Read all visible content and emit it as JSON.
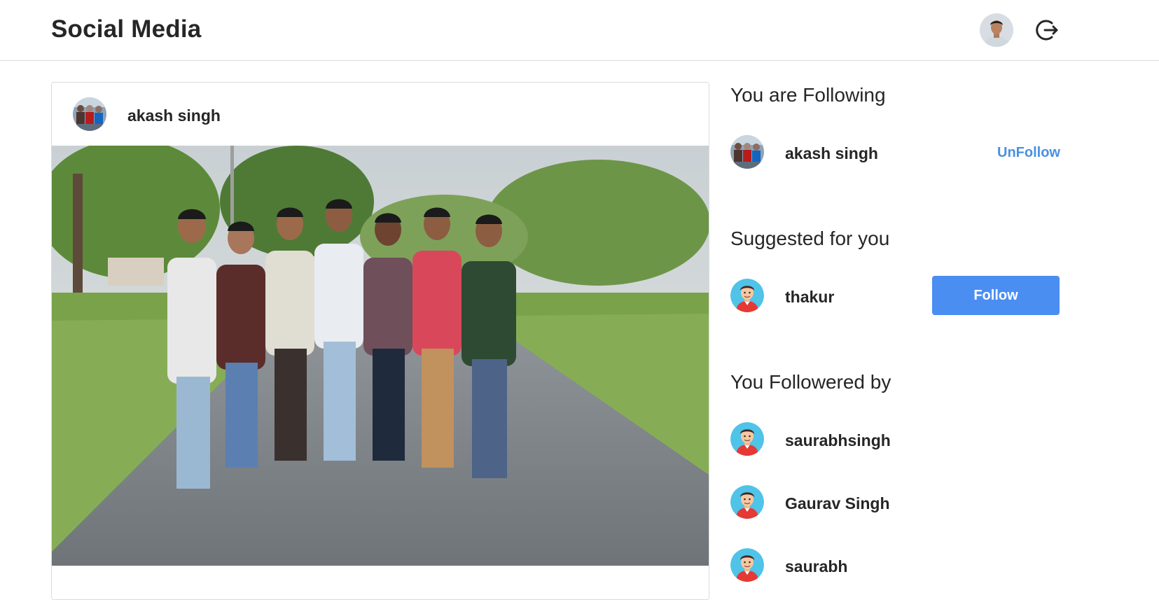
{
  "header": {
    "brand": "Social Media"
  },
  "post": {
    "username": "akash singh"
  },
  "following": {
    "title": "You are Following",
    "users": [
      {
        "name": "akash singh",
        "action": "UnFollow"
      }
    ]
  },
  "suggested": {
    "title": "Suggested for you",
    "users": [
      {
        "name": "thakur",
        "action": "Follow"
      }
    ]
  },
  "followers": {
    "title": "You Followered by",
    "users": [
      {
        "name": "saurabhsingh"
      },
      {
        "name": "Gaurav Singh"
      },
      {
        "name": "saurabh"
      }
    ]
  },
  "colors": {
    "accent": "#4a8ef2",
    "link": "#4a90e2",
    "border": "#dbdbdb",
    "text": "#262626"
  }
}
